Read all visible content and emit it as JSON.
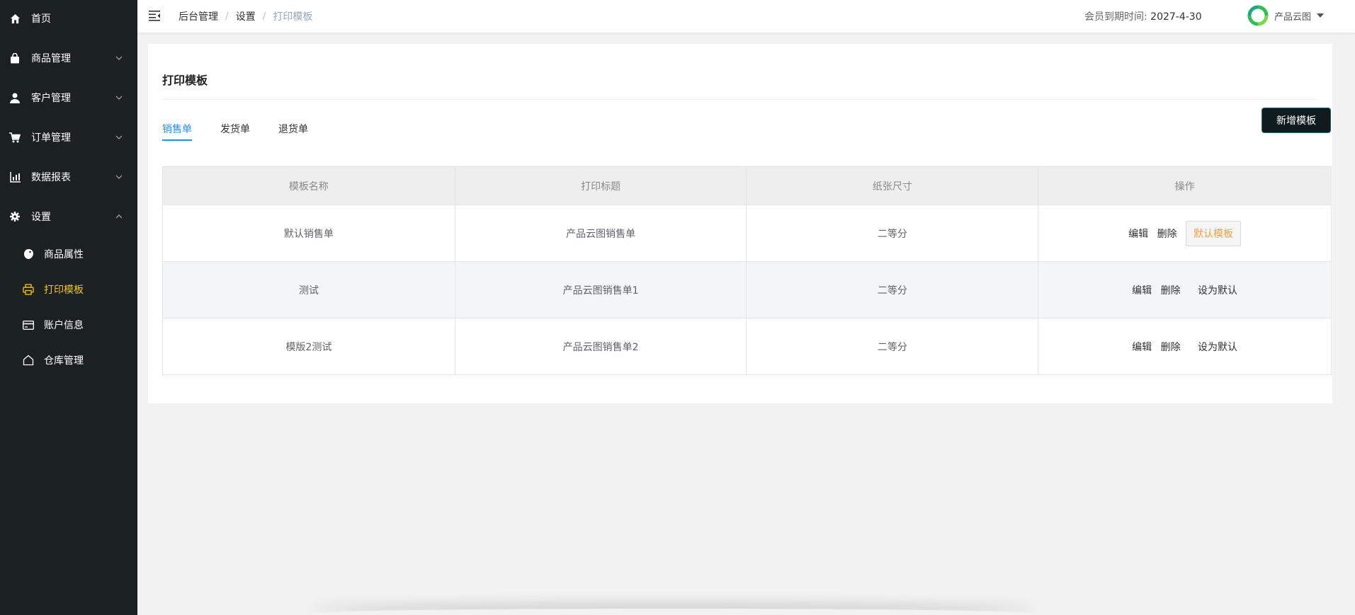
{
  "sidebar": {
    "menu": [
      {
        "label": "首页",
        "icon": "home-icon"
      },
      {
        "label": "商品管理",
        "icon": "bag-icon"
      },
      {
        "label": "客户管理",
        "icon": "user-icon"
      },
      {
        "label": "订单管理",
        "icon": "cart-icon"
      },
      {
        "label": "数据报表",
        "icon": "chart-icon"
      },
      {
        "label": "设置",
        "icon": "gear-icon"
      }
    ],
    "submenu": [
      {
        "label": "商品属性",
        "icon": "tag-icon"
      },
      {
        "label": "打印模板",
        "icon": "printer-icon"
      },
      {
        "label": "账户信息",
        "icon": "card-icon"
      },
      {
        "label": "仓库管理",
        "icon": "warehouse-icon"
      }
    ],
    "active_color": "#f5c518"
  },
  "header": {
    "breadcrumb": [
      "后台管理",
      "设置",
      "打印模板"
    ],
    "membership_label": "会员到期时间:",
    "membership_date": "2027-4-30",
    "user_name": "产品云图"
  },
  "main": {
    "title": "打印模板",
    "tabs": [
      "销售单",
      "发货单",
      "退货单"
    ],
    "add_button": "新增模板",
    "table": {
      "columns": [
        "模板名称",
        "打印标题",
        "纸张尺寸",
        "操作"
      ],
      "rows": [
        {
          "name": "默认销售单",
          "title": "产品云图销售单",
          "size": "二等分",
          "is_default": true
        },
        {
          "name": "测试",
          "title": "产品云图销售单1",
          "size": "二等分",
          "is_default": false
        },
        {
          "name": "模版2测试",
          "title": "产品云图销售单2",
          "size": "二等分",
          "is_default": false
        }
      ],
      "ops": {
        "edit": "编辑",
        "delete": "删除",
        "default_tag": "默认模板",
        "set_default": "设为默认"
      }
    }
  },
  "colors": {
    "sidebar_bg": "#1b2121",
    "tab_active": "#1890ff",
    "default_tag": "#f0a040"
  }
}
